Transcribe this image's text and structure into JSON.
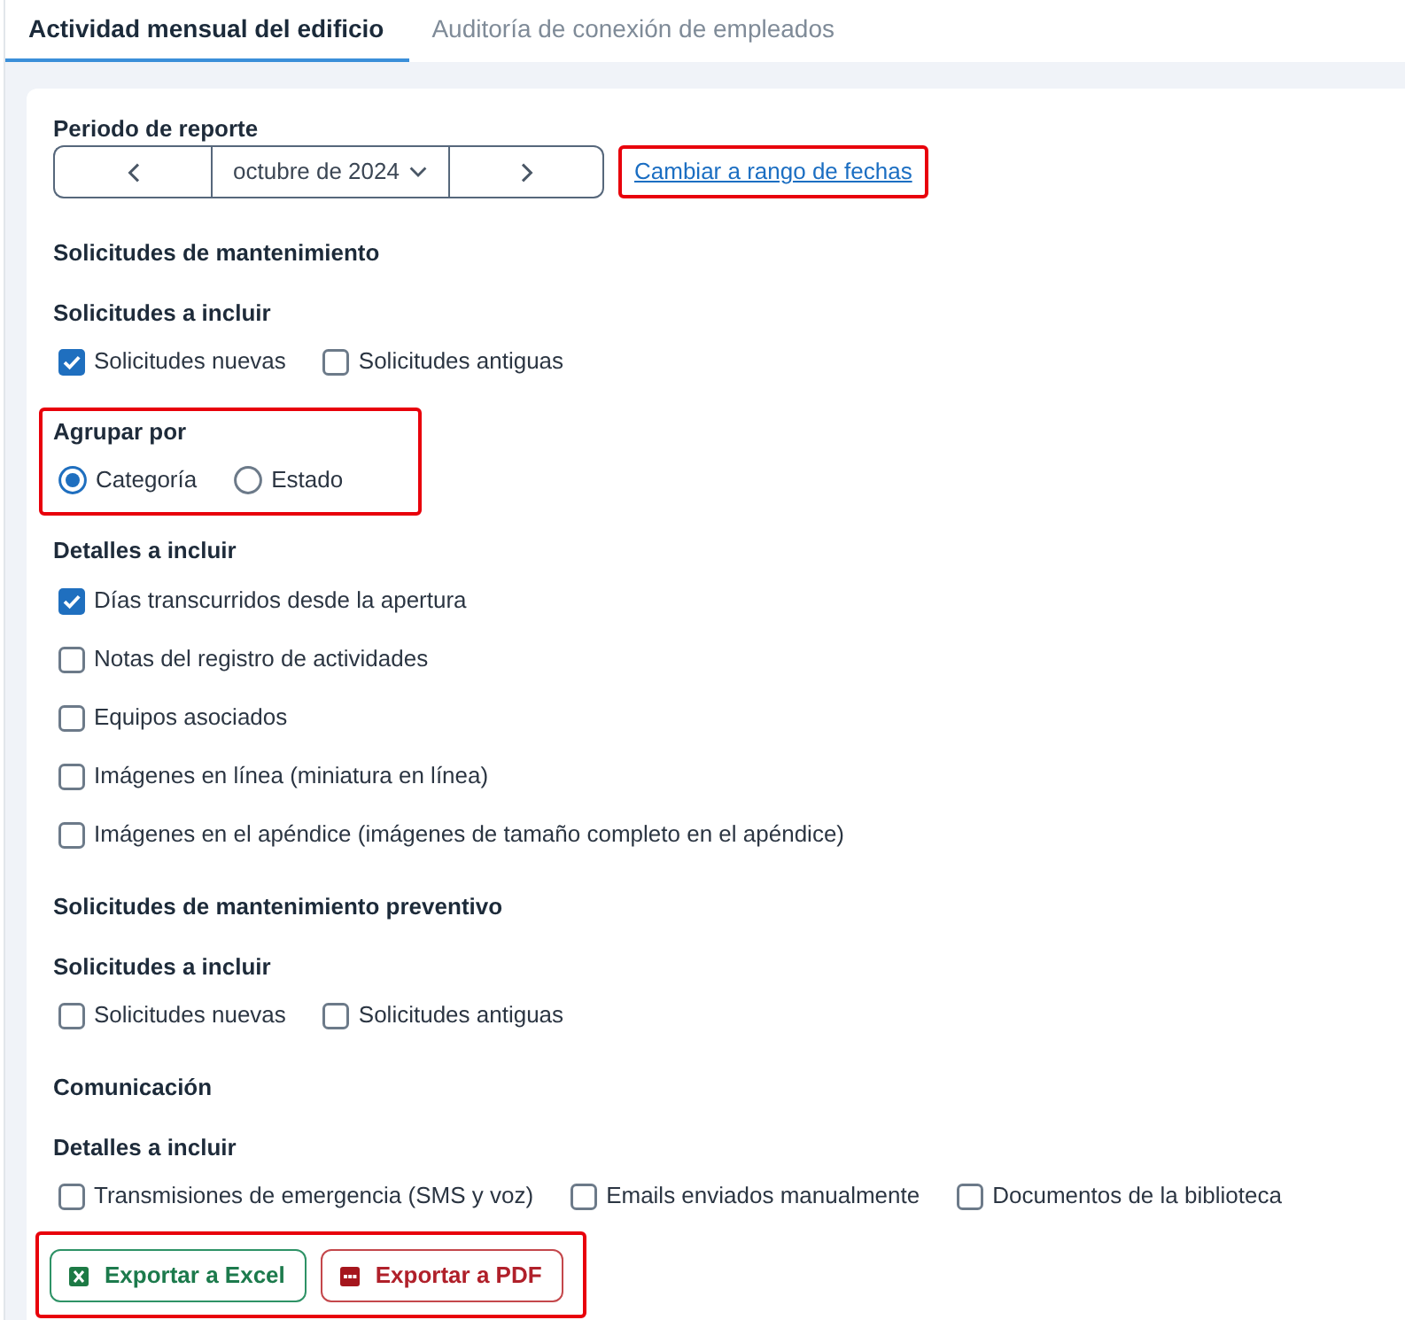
{
  "tabs": [
    {
      "label": "Actividad mensual del edificio",
      "selected": true
    },
    {
      "label": "Auditoría de conexión de empleados",
      "selected": false
    }
  ],
  "report_period": {
    "label": "Periodo de reporte",
    "month": "octubre de 2024",
    "date_range_link": {
      "text": "Cambiar a rango de fechas",
      "highlighted": true
    }
  },
  "sections": [
    {
      "title": "Solicitudes de mantenimiento",
      "groups": [
        {
          "kind": "checkbox_row",
          "label": "Solicitudes a incluir",
          "highlighted": false,
          "options": [
            {
              "label": "Solicitudes nuevas",
              "checked": true
            },
            {
              "label": "Solicitudes antiguas",
              "checked": false
            }
          ]
        },
        {
          "kind": "radio_row",
          "label": "Agrupar por",
          "highlighted": true,
          "options": [
            {
              "label": "Categoría",
              "selected": true
            },
            {
              "label": "Estado",
              "selected": false
            }
          ]
        },
        {
          "kind": "checkbox_list",
          "label": "Detalles a incluir",
          "highlighted": false,
          "options": [
            {
              "label": "Días transcurridos desde la apertura",
              "checked": true
            },
            {
              "label": "Notas del registro de actividades",
              "checked": false
            },
            {
              "label": "Equipos asociados",
              "checked": false
            },
            {
              "label": "Imágenes en línea (miniatura en línea)",
              "checked": false
            },
            {
              "label": "Imágenes en el apéndice (imágenes de tamaño completo en el apéndice)",
              "checked": false
            }
          ]
        }
      ]
    },
    {
      "title": "Solicitudes de mantenimiento preventivo",
      "groups": [
        {
          "kind": "checkbox_row",
          "label": "Solicitudes a incluir",
          "highlighted": false,
          "options": [
            {
              "label": "Solicitudes nuevas",
              "checked": false
            },
            {
              "label": "Solicitudes antiguas",
              "checked": false
            }
          ]
        }
      ]
    },
    {
      "title": "Comunicación",
      "groups": [
        {
          "kind": "checkbox_row",
          "label": "Detalles a incluir",
          "highlighted": false,
          "options": [
            {
              "label": "Transmisiones de emergencia (SMS y voz)",
              "checked": false
            },
            {
              "label": "Emails enviados manualmente",
              "checked": false
            },
            {
              "label": "Documentos de la biblioteca",
              "checked": false
            }
          ]
        }
      ]
    }
  ],
  "export": {
    "highlighted": true,
    "buttons": [
      {
        "kind": "excel",
        "label": "Exportar a Excel"
      },
      {
        "kind": "pdf",
        "label": "Exportar a PDF"
      }
    ]
  }
}
